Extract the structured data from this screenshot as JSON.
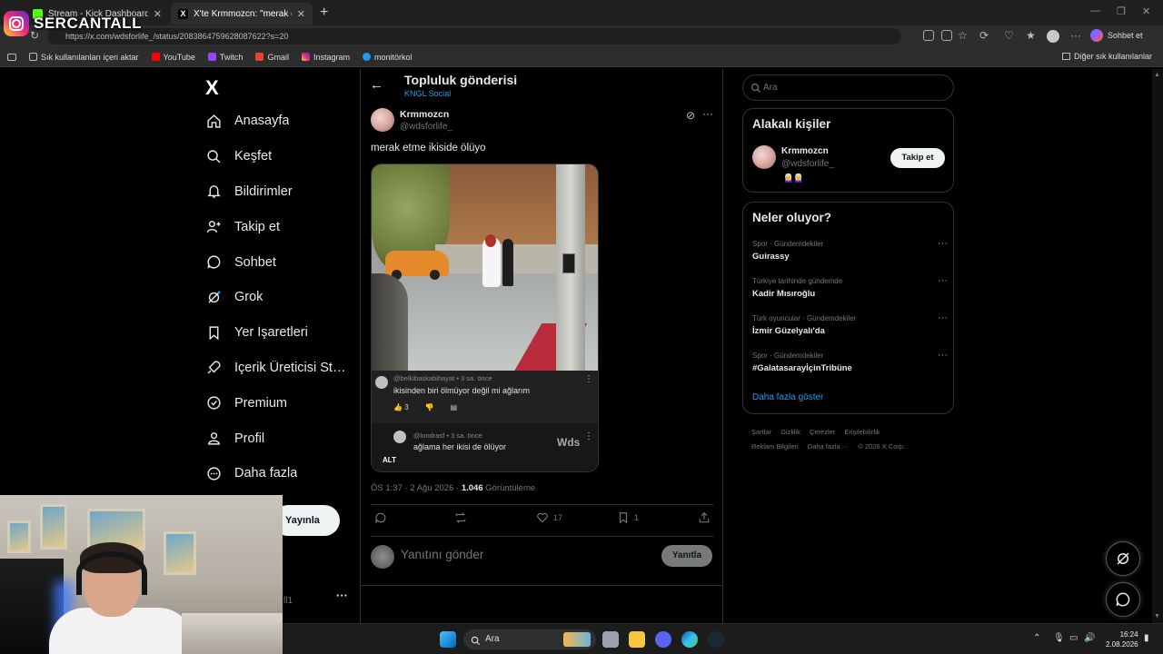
{
  "browser": {
    "tabs": [
      {
        "title": "Stream - Kick Dashboard",
        "active": false
      },
      {
        "title": "X'te Krmmozcn: \"merak etme ikisi de ölüyo\"",
        "active": true
      }
    ],
    "url": "https://x.com/wdsforlife_/status/2083864759628087622?s=20",
    "copilot_label": "Sohbet et",
    "bookmarks": [
      "Sık kullanılanları içeri aktar",
      "YouTube",
      "Twitch",
      "Gmail",
      "Instagram",
      "monitörkol"
    ],
    "bookmarks_other": "Diğer sık kullanılanlar"
  },
  "overlay": {
    "instagram_name": "SERCANTALL"
  },
  "nav": {
    "logo": "X",
    "items": [
      {
        "label": "Anasayfa",
        "icon": "home-icon"
      },
      {
        "label": "Keşfet",
        "icon": "search-icon"
      },
      {
        "label": "Bildirimler",
        "icon": "bell-icon"
      },
      {
        "label": "Takip et",
        "icon": "person-add-icon"
      },
      {
        "label": "Sohbet",
        "icon": "chat-icon"
      },
      {
        "label": "Grok",
        "icon": "grok-icon"
      },
      {
        "label": "Yer İşaretleri",
        "icon": "bookmark-icon"
      },
      {
        "label": "İçerik Üreticisi Stüdyosu",
        "icon": "rocket-icon"
      },
      {
        "label": "Premium",
        "icon": "verified-icon"
      },
      {
        "label": "Profil",
        "icon": "person-icon"
      },
      {
        "label": "Daha fazla",
        "icon": "more-circle-icon"
      }
    ],
    "post_button": "Yayınla",
    "account_more": "···",
    "account_name": "ll1"
  },
  "header": {
    "title": "Topluluk gönderisi",
    "subtitle": "KNGL Social"
  },
  "tweet": {
    "name": "Krmmozcn",
    "handle": "@wdsforlife_",
    "text": "merak etme ikiside ölüyo",
    "comment1": {
      "user": "@belkibaskabihayat",
      "time": "3 sa. önce",
      "text": "ikisinden biri ölmüyor değil mi ağlarım",
      "likes": "3"
    },
    "comment2": {
      "user": "@londrasf",
      "time": "3 sa. önce",
      "text": "ağlama her ikisi de ölüyor",
      "watermark": "Wds"
    },
    "alt_badge": "ALT",
    "time": "ÖS 1:37 · 2 Ağu 2026 · ",
    "views_count": "1.046",
    "views_label": " Görüntüleme",
    "likes": "17",
    "bookmarks": "1",
    "reply_placeholder": "Yanıtını gönder",
    "reply_button": "Yanıtla"
  },
  "sidebar": {
    "search_placeholder": "Ara",
    "related_title": "Alakalı kişiler",
    "related": {
      "name": "Krmmozcn",
      "handle": "@wdsforlife_",
      "emoji": "👩‍🦳👩‍🦳",
      "follow": "Takip et"
    },
    "trends_title": "Neler oluyor?",
    "trends": [
      {
        "context": "Spor · Gündemdekiler",
        "name": "Guirassy"
      },
      {
        "context": "Türkiye tarihinde gündemde",
        "name": "Kadir Mısıroğlu"
      },
      {
        "context": "Türk oyuncular · Gündemdekiler",
        "name": "İzmir Güzelyalı'da"
      },
      {
        "context": "Spor · Gündemdekiler",
        "name": "#GalatasarayİçinTribüne"
      }
    ],
    "show_more": "Daha fazla göster",
    "footer": [
      "Şartlar",
      "Gizlilik",
      "Çerezler",
      "Erişilebilirlik",
      "Reklam Bilgileri",
      "Daha fazla ···",
      "© 2026 X Corp."
    ]
  },
  "taskbar": {
    "search": "Ara",
    "time": "16:24",
    "date": "2.08.2026"
  }
}
